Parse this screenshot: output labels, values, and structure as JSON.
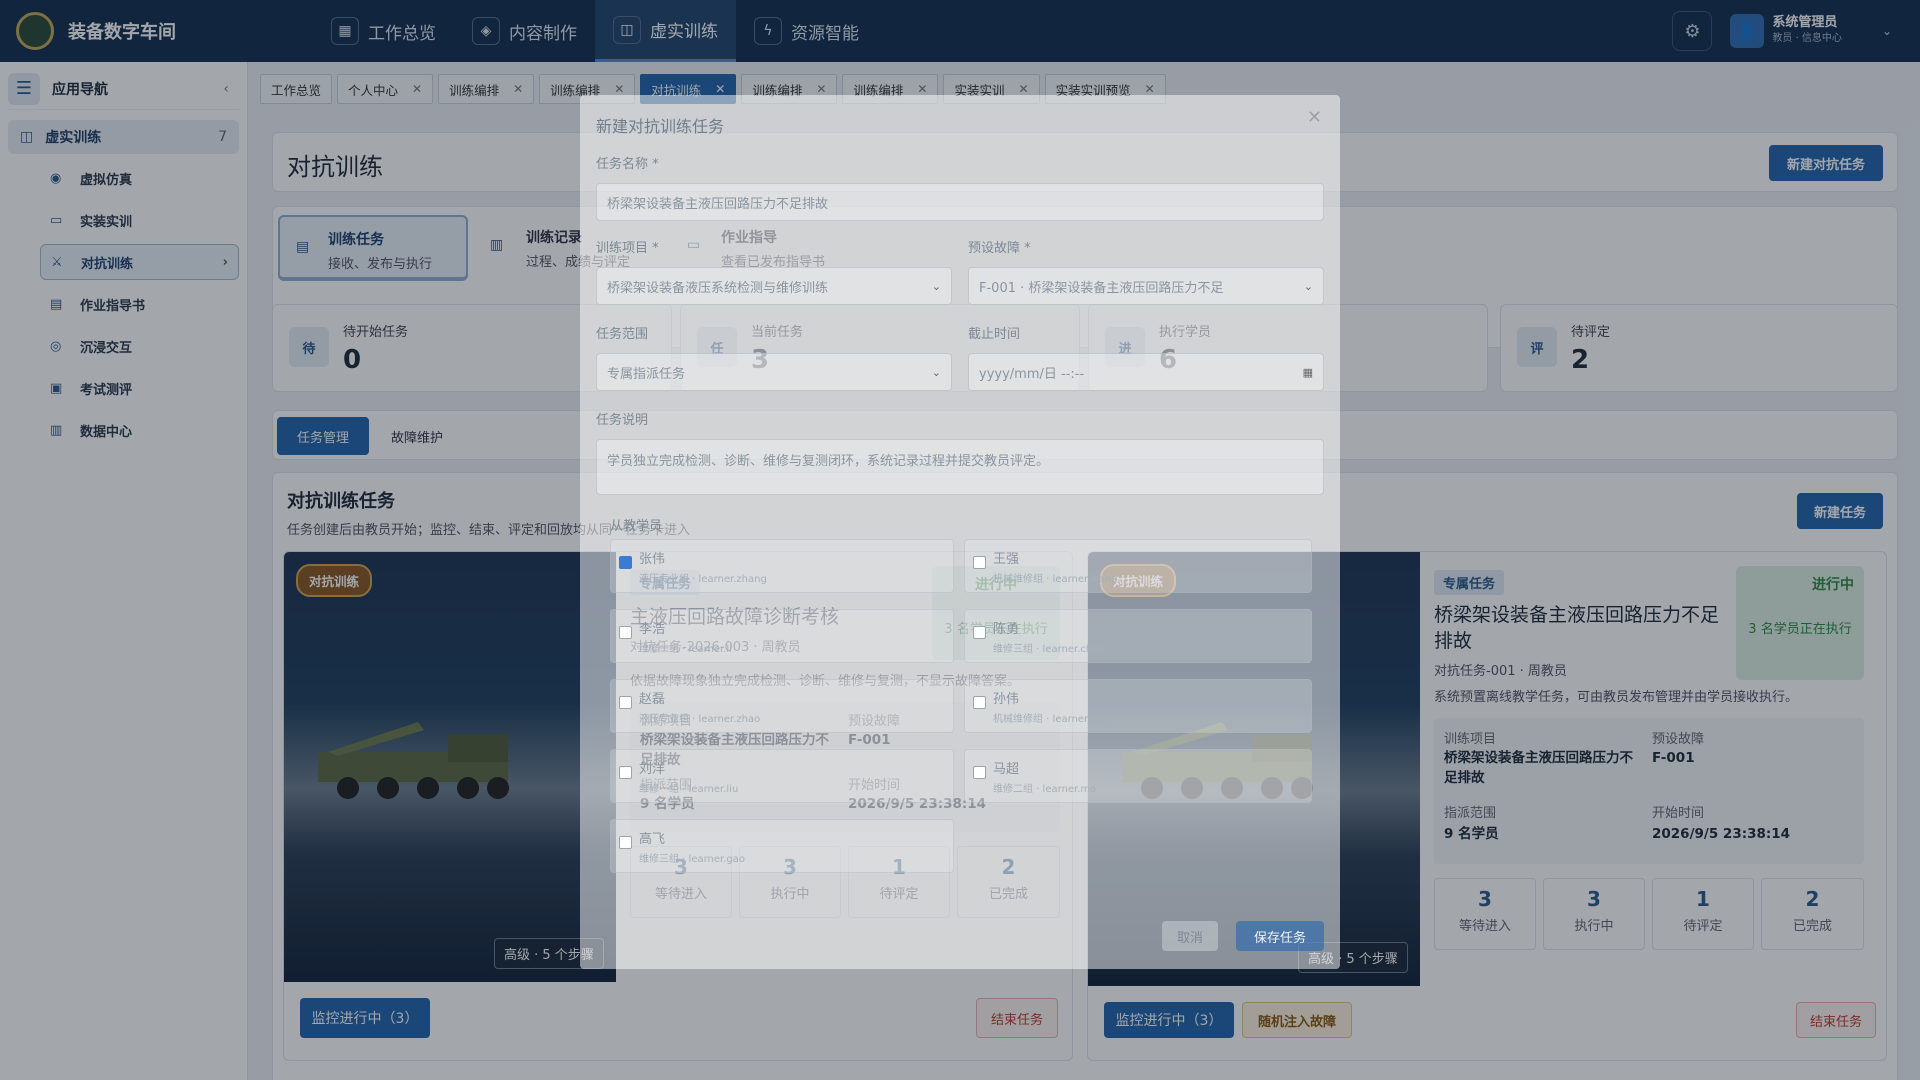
{
  "app": {
    "title": "装备数字车间"
  },
  "topnav": [
    {
      "label": "工作总览",
      "icon": "grid-icon"
    },
    {
      "label": "内容制作",
      "icon": "cube-icon"
    },
    {
      "label": "虚实训练",
      "icon": "book-icon"
    },
    {
      "label": "资源智能",
      "icon": "ai-icon"
    }
  ],
  "user": {
    "name": "系统管理员",
    "role": "教员 · 信息中心"
  },
  "sidebar": {
    "title": "应用导航",
    "group": {
      "label": "虚实训练",
      "count": "7"
    },
    "items": [
      {
        "label": "虚拟仿真",
        "icon": "play-circle-icon"
      },
      {
        "label": "实装实训",
        "icon": "monitor-icon"
      },
      {
        "label": "对抗训练",
        "icon": "swords-icon"
      },
      {
        "label": "作业指导书",
        "icon": "file-icon"
      },
      {
        "label": "沉浸交互",
        "icon": "vr-icon"
      },
      {
        "label": "考试测评",
        "icon": "clipboard-icon"
      },
      {
        "label": "数据中心",
        "icon": "chart-icon"
      }
    ]
  },
  "tabs": [
    "工作总览",
    "个人中心",
    "训练编排",
    "训练编排",
    "对抗训练",
    "训练编排",
    "训练编排",
    "实装实训",
    "实装实训预览"
  ],
  "page": {
    "title": "对抗训练",
    "new_btn": "新建对抗任务"
  },
  "subtabs": [
    {
      "title": "训练任务",
      "desc": "接收、发布与执行"
    },
    {
      "title": "训练记录",
      "desc": "过程、成绩与评定"
    },
    {
      "title": "作业指导",
      "desc": "查看已发布指导书"
    }
  ],
  "stats": [
    {
      "badge": "待",
      "label": "待开始任务",
      "value": "0"
    },
    {
      "badge": "任",
      "label": "当前任务",
      "value": "3"
    },
    {
      "badge": "进",
      "label": "执行学员",
      "value": "6"
    },
    {
      "badge": "评",
      "label": "待评定",
      "value": "2"
    }
  ],
  "mgmt_tabs": [
    "任务管理",
    "故障维护"
  ],
  "section": {
    "title": "对抗训练任务",
    "desc": "任务创建后由教员开始；监控、结束、评定和回放均从同一任务卡进入",
    "new_btn": "新建任务"
  },
  "cards": [
    {
      "badge": "对抗训练",
      "level": "高级 · 5 个步骤",
      "tag": "专属任务",
      "status": "进行中",
      "status_desc": "3 名学员正在执行",
      "title": "主液压回路故障诊断考核",
      "code": "对抗任务-2026-003 · 周教员",
      "desc": "依据故障现象独立完成检测、诊断、维修与复测，不显示故障答案。",
      "k1": "训练项目",
      "v1": "桥梁架设装备主液压回路压力不足排故",
      "k2": "预设故障",
      "v2": "F-001",
      "k3": "指派范围",
      "v3": "9 名学员",
      "k4": "开始时间",
      "v4": "2026/9/5 23:38:14",
      "counts": [
        {
          "n": "3",
          "s": "等待进入"
        },
        {
          "n": "3",
          "s": "执行中"
        },
        {
          "n": "1",
          "s": "待评定"
        },
        {
          "n": "2",
          "s": "已完成"
        }
      ],
      "monitor": "监控进行中（3）",
      "end": "结束任务"
    },
    {
      "badge": "对抗训练",
      "level": "高级 · 5 个步骤",
      "tag": "专属任务",
      "status": "进行中",
      "status_desc": "3 名学员正在执行",
      "title": "桥梁架设装备主液压回路压力不足排故",
      "code": "对抗任务-001 · 周教员",
      "desc": "系统预置离线教学任务，可由教员发布管理并由学员接收执行。",
      "k1": "训练项目",
      "v1": "桥梁架设装备主液压回路压力不足排故",
      "k2": "预设故障",
      "v2": "F-001",
      "k3": "指派范围",
      "v3": "9 名学员",
      "k4": "开始时间",
      "v4": "2026/9/5 23:38:14",
      "counts": [
        {
          "n": "3",
          "s": "等待进入"
        },
        {
          "n": "3",
          "s": "执行中"
        },
        {
          "n": "1",
          "s": "待评定"
        },
        {
          "n": "2",
          "s": "已完成"
        }
      ],
      "monitor": "监控进行中（3）",
      "inject": "随机注入故障",
      "end": "结束任务"
    }
  ],
  "modal": {
    "title": "新建对抗训练任务",
    "name_label": "任务名称 *",
    "name_value": "桥梁架设装备主液压回路压力不足排故",
    "project_label": "训练项目 *",
    "project_value": "桥梁架设装备液压系统检测与维修训练",
    "fault_label": "预设故障 *",
    "fault_value": "F-001 · 桥梁架设装备主液压回路压力不足",
    "scope_label": "任务范围",
    "scope_value": "专属指派任务",
    "deadline_label": "截止时间",
    "deadline_placeholder": "yyyy/mm/日 --:--",
    "desc_label": "任务说明",
    "desc_value": "学员独立完成检测、诊断、维修与复测闭环，系统记录过程并提交教员评定。",
    "students_label": "从教学员",
    "students": [
      {
        "name": "张伟",
        "detail": "液压专业组 · learner.zhang",
        "checked": true
      },
      {
        "name": "王强",
        "detail": "机械维修组 · learner.wang",
        "checked": false
      },
      {
        "name": "李浩",
        "detail": "维修一组 · learner.li",
        "checked": false
      },
      {
        "name": "陈勇",
        "detail": "维修三组 · learner.chen",
        "checked": false
      },
      {
        "name": "赵磊",
        "detail": "液压专业组 · learner.zhao",
        "checked": false
      },
      {
        "name": "孙伟",
        "detail": "机械维修组 · learner.sun",
        "checked": false
      },
      {
        "name": "刘洋",
        "detail": "维修一组 · learner.liu",
        "checked": false
      },
      {
        "name": "马超",
        "detail": "维修二组 · learner.ma",
        "checked": false
      },
      {
        "name": "高飞",
        "detail": "维修三组 · learner.gao",
        "checked": false
      }
    ],
    "cancel": "取消",
    "save": "保存任务"
  }
}
